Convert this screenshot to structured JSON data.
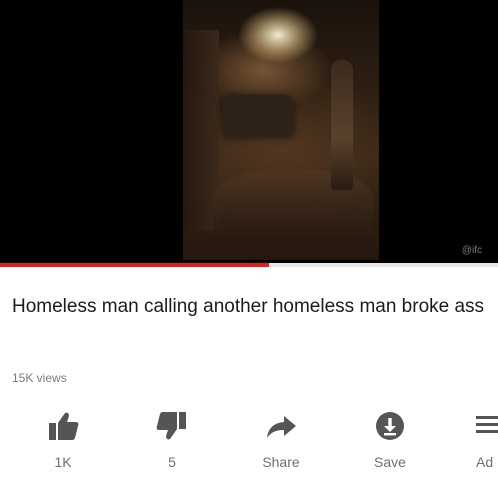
{
  "video": {
    "watermark": "@ifc",
    "progress_fraction": 0.54
  },
  "title": "Homeless man calling another homeless man broke ass",
  "views": "15K views",
  "actions": [
    {
      "label": "1K",
      "icon": "thumbs-up-icon"
    },
    {
      "label": "5",
      "icon": "thumbs-down-icon"
    },
    {
      "label": "Share",
      "icon": "share-icon"
    },
    {
      "label": "Save",
      "icon": "save-icon"
    },
    {
      "label": "Ad",
      "icon": "add-to-playlist-icon"
    }
  ],
  "colors": {
    "progress": "#e21f1f",
    "icon": "#555555",
    "text": "#1b1b1b"
  }
}
